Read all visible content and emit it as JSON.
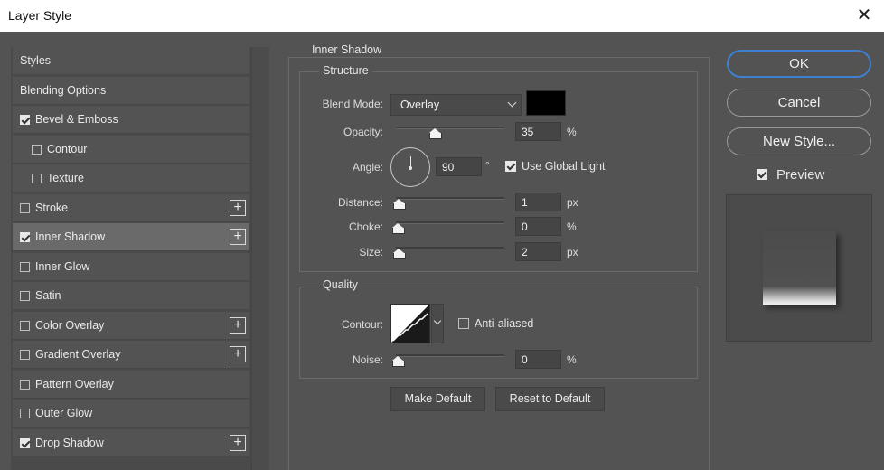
{
  "window": {
    "title": "Layer Style",
    "close_glyph": "✕"
  },
  "sidebar": {
    "items": [
      {
        "label": "Styles",
        "checkbox": false,
        "checked": false,
        "plus": false,
        "active": false
      },
      {
        "label": "Blending Options",
        "checkbox": false,
        "checked": false,
        "plus": false,
        "active": false
      },
      {
        "label": "Bevel & Emboss",
        "checkbox": true,
        "checked": true,
        "plus": false,
        "active": false
      },
      {
        "label": "Contour",
        "checkbox": true,
        "checked": false,
        "plus": false,
        "active": false,
        "indent": true
      },
      {
        "label": "Texture",
        "checkbox": true,
        "checked": false,
        "plus": false,
        "active": false,
        "indent": true
      },
      {
        "label": "Stroke",
        "checkbox": true,
        "checked": false,
        "plus": true,
        "active": false
      },
      {
        "label": "Inner Shadow",
        "checkbox": true,
        "checked": true,
        "plus": true,
        "active": true
      },
      {
        "label": "Inner Glow",
        "checkbox": true,
        "checked": false,
        "plus": false,
        "active": false
      },
      {
        "label": "Satin",
        "checkbox": true,
        "checked": false,
        "plus": false,
        "active": false
      },
      {
        "label": "Color Overlay",
        "checkbox": true,
        "checked": false,
        "plus": true,
        "active": false
      },
      {
        "label": "Gradient Overlay",
        "checkbox": true,
        "checked": false,
        "plus": true,
        "active": false
      },
      {
        "label": "Pattern Overlay",
        "checkbox": true,
        "checked": false,
        "plus": false,
        "active": false
      },
      {
        "label": "Outer Glow",
        "checkbox": true,
        "checked": false,
        "plus": false,
        "active": false
      },
      {
        "label": "Drop Shadow",
        "checkbox": true,
        "checked": true,
        "plus": true,
        "active": false
      }
    ],
    "plus_glyph": "+"
  },
  "panel": {
    "title": "Inner Shadow",
    "structure": {
      "title": "Structure",
      "blend_mode_label": "Blend Mode:",
      "blend_mode_value": "Overlay",
      "swatch_color": "#000000",
      "opacity_label": "Opacity:",
      "opacity_value": "35",
      "opacity_unit": "%",
      "opacity_level": 0.35,
      "angle_label": "Angle:",
      "angle_value": "90",
      "angle_unit": "°",
      "use_global_light_label": "Use Global Light",
      "use_global_light_checked": true,
      "distance_label": "Distance:",
      "distance_value": "1",
      "distance_unit": "px",
      "distance_level": 0.01,
      "choke_label": "Choke:",
      "choke_value": "0",
      "choke_unit": "%",
      "choke_level": 0,
      "size_label": "Size:",
      "size_value": "2",
      "size_unit": "px",
      "size_level": 0.01
    },
    "quality": {
      "title": "Quality",
      "contour_label": "Contour:",
      "anti_aliased_label": "Anti-aliased",
      "anti_aliased_checked": false,
      "noise_label": "Noise:",
      "noise_value": "0",
      "noise_unit": "%",
      "noise_level": 0
    },
    "make_default_label": "Make Default",
    "reset_default_label": "Reset to Default"
  },
  "actions": {
    "ok_label": "OK",
    "cancel_label": "Cancel",
    "new_style_label": "New Style...",
    "preview_label": "Preview",
    "preview_checked": true
  },
  "colors": {
    "accent": "#3f7fcf",
    "panel_bg": "#535353"
  }
}
